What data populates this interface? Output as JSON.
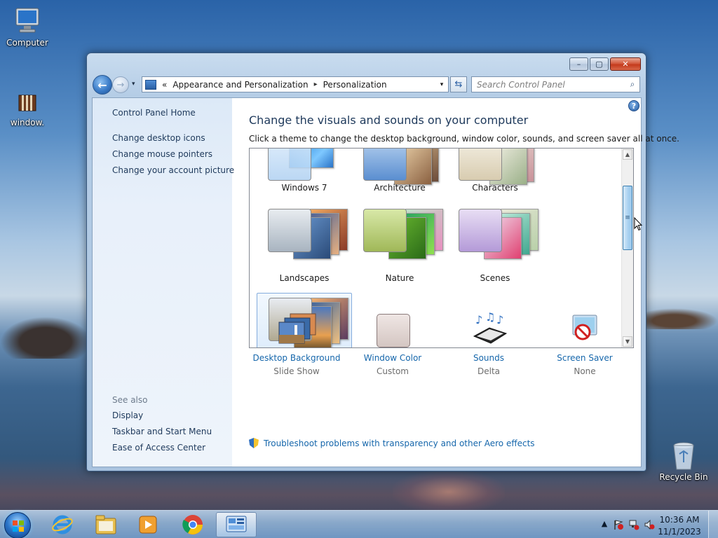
{
  "desktop": {
    "icons": [
      {
        "label": "Computer"
      },
      {
        "label": "window."
      },
      {
        "label": "Recycle Bin"
      }
    ]
  },
  "window": {
    "controls": {
      "minimize": "–",
      "maximize": "▢",
      "close": "✕"
    },
    "nav": {
      "back": "←",
      "forward": "→",
      "recent": "▾"
    },
    "address": {
      "overflow": "«",
      "crumbs": [
        "Appearance and Personalization",
        "Personalization"
      ],
      "separator": "▸",
      "dropdown": "▾"
    },
    "refresh": "⇆",
    "search": {
      "placeholder": "Search Control Panel",
      "icon": "⌕"
    },
    "sidebar": {
      "home": "Control Panel Home",
      "tasks": [
        "Change desktop icons",
        "Change mouse pointers",
        "Change your account picture"
      ],
      "see_also_title": "See also",
      "see_also": [
        "Display",
        "Taskbar and Start Menu",
        "Ease of Access Center"
      ]
    },
    "main": {
      "help": "?",
      "title": "Change the visuals and sounds on your computer",
      "description": "Click a theme to change the desktop background, window color, sounds, and screen saver all at once.",
      "themes": [
        {
          "name": "Windows 7"
        },
        {
          "name": "Architecture"
        },
        {
          "name": "Characters"
        },
        {
          "name": "Landscapes"
        },
        {
          "name": "Nature"
        },
        {
          "name": "Scenes"
        },
        {
          "name": ""
        }
      ],
      "scroll": {
        "up": "▲",
        "down": "▼",
        "grip": "≡"
      },
      "settings": [
        {
          "label": "Desktop Background",
          "value": "Slide Show"
        },
        {
          "label": "Window Color",
          "value": "Custom"
        },
        {
          "label": "Sounds",
          "value": "Delta"
        },
        {
          "label": "Screen Saver",
          "value": "None"
        }
      ],
      "troubleshoot": "Troubleshoot problems with transparency and other Aero effects"
    }
  },
  "taskbar": {
    "tray": {
      "expand": "▲",
      "time": "10:36 AM",
      "date": "11/1/2023"
    }
  },
  "colors": {
    "link": "#1566ab",
    "heading": "#1e395b",
    "sidebar_text": "#1e395b"
  }
}
